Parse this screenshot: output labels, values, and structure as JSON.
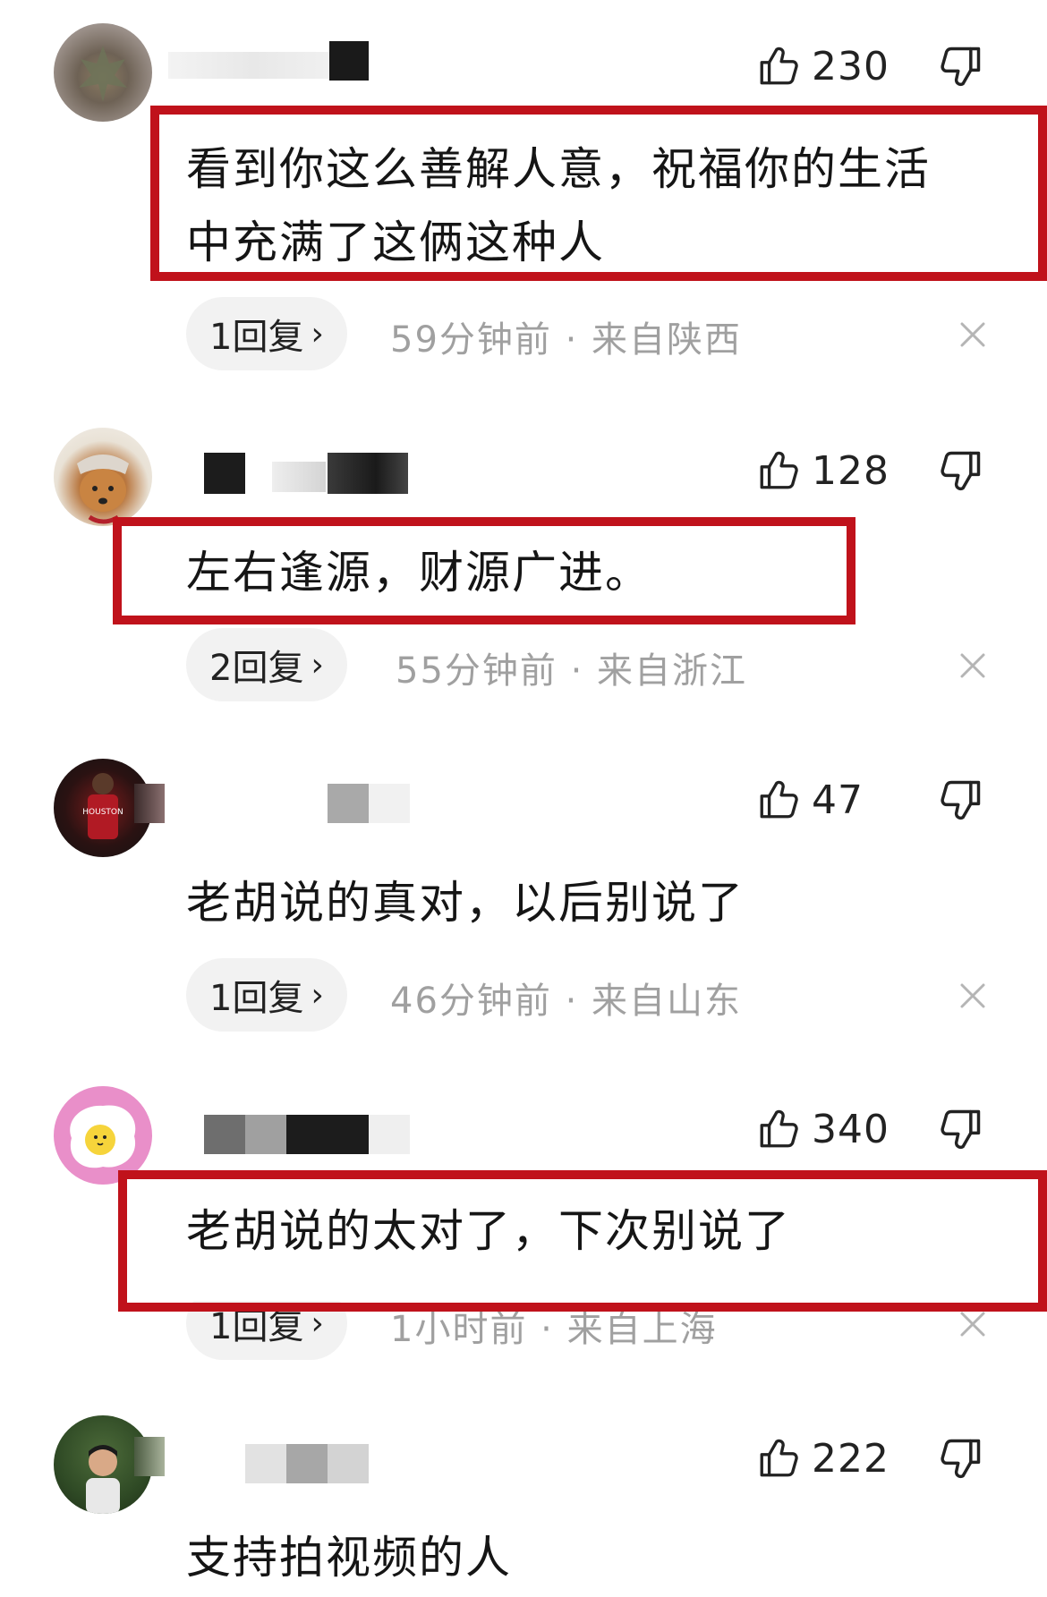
{
  "comments": [
    {
      "likes": "230",
      "text_lines": [
        "看到你这么善解人意，祝福你的生活",
        "中充满了这俩这种人"
      ],
      "reply_label": "1回复",
      "meta": "59分钟前 · 来自陕西",
      "highlighted": true
    },
    {
      "likes": "128",
      "text_lines": [
        "左右逢源，财源广进。"
      ],
      "reply_label": "2回复",
      "meta": "55分钟前 · 来自浙江",
      "highlighted": true
    },
    {
      "likes": "47",
      "text_lines": [
        "老胡说的真对，以后别说了"
      ],
      "reply_label": "1回复",
      "meta": "46分钟前 · 来自山东",
      "highlighted": false
    },
    {
      "likes": "340",
      "text_lines": [
        "老胡说的太对了，下次别说了"
      ],
      "reply_label": "1回复",
      "meta": "1小时前 · 来自上海",
      "highlighted": true
    },
    {
      "likes": "222",
      "text_lines": [
        "支持拍视频的人"
      ],
      "highlighted": false
    }
  ],
  "icons": {
    "like": "thumbs-up-outline-icon",
    "dislike": "thumbs-down-outline-icon",
    "close": "close-icon",
    "chevron": "chevron-right-icon"
  },
  "colors": {
    "highlight": "#c0121b",
    "meta_text": "#a0a0a0",
    "pill_bg": "#f2f2f2"
  }
}
